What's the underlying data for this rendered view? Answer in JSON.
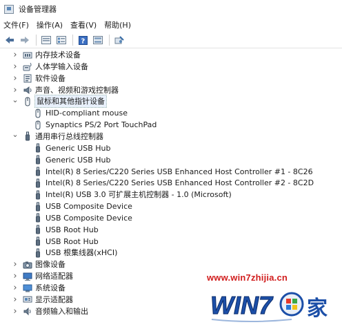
{
  "window": {
    "title": "设备管理器"
  },
  "menu": [
    "文件(F)",
    "操作(A)",
    "查看(V)",
    "帮助(H)"
  ],
  "toolbar": [
    "back-icon",
    "forward-icon",
    "sep",
    "properties-icon",
    "details-icon",
    "sep",
    "help-icon",
    "view-icon",
    "sep",
    "scan-icon"
  ],
  "tree": [
    {
      "depth": 0,
      "expander": "collapsed",
      "icon": "memory-icon",
      "label": "内存技术设备"
    },
    {
      "depth": 0,
      "expander": "collapsed",
      "icon": "human-input-icon",
      "label": "人体学输入设备"
    },
    {
      "depth": 0,
      "expander": "collapsed",
      "icon": "software-device-icon",
      "label": "软件设备"
    },
    {
      "depth": 0,
      "expander": "collapsed",
      "icon": "speaker-icon",
      "label": "声音、视频和游戏控制器"
    },
    {
      "depth": 0,
      "expander": "expanded",
      "icon": "mouse-icon",
      "label": "鼠标和其他指针设备",
      "selected": true
    },
    {
      "depth": 1,
      "expander": "none",
      "icon": "mouse-icon",
      "label": "HID-compliant mouse"
    },
    {
      "depth": 1,
      "expander": "none",
      "icon": "mouse-icon",
      "label": "Synaptics PS/2 Port TouchPad"
    },
    {
      "depth": 0,
      "expander": "expanded",
      "icon": "usb-icon",
      "label": "通用串行总线控制器"
    },
    {
      "depth": 1,
      "expander": "none",
      "icon": "usb-icon",
      "label": "Generic USB Hub"
    },
    {
      "depth": 1,
      "expander": "none",
      "icon": "usb-icon",
      "label": "Generic USB Hub"
    },
    {
      "depth": 1,
      "expander": "none",
      "icon": "usb-icon",
      "label": "Intel(R) 8 Series/C220 Series USB Enhanced Host Controller #1 - 8C26"
    },
    {
      "depth": 1,
      "expander": "none",
      "icon": "usb-icon",
      "label": "Intel(R) 8 Series/C220 Series USB Enhanced Host Controller #2 - 8C2D"
    },
    {
      "depth": 1,
      "expander": "none",
      "icon": "usb-icon",
      "label": "Intel(R) USB 3.0 可扩展主机控制器 - 1.0 (Microsoft)"
    },
    {
      "depth": 1,
      "expander": "none",
      "icon": "usb-icon",
      "label": "USB Composite Device"
    },
    {
      "depth": 1,
      "expander": "none",
      "icon": "usb-icon",
      "label": "USB Composite Device"
    },
    {
      "depth": 1,
      "expander": "none",
      "icon": "usb-icon",
      "label": "USB Root Hub"
    },
    {
      "depth": 1,
      "expander": "none",
      "icon": "usb-icon",
      "label": "USB Root Hub"
    },
    {
      "depth": 1,
      "expander": "none",
      "icon": "usb-icon",
      "label": "USB 根集线器(xHCI)"
    },
    {
      "depth": 0,
      "expander": "collapsed",
      "icon": "camera-icon",
      "label": "图像设备"
    },
    {
      "depth": 0,
      "expander": "collapsed",
      "icon": "network-adapter-icon",
      "label": "网络适配器"
    },
    {
      "depth": 0,
      "expander": "collapsed",
      "icon": "system-device-icon",
      "label": "系统设备"
    },
    {
      "depth": 0,
      "expander": "collapsed",
      "icon": "display-adapter-icon",
      "label": "显示适配器"
    },
    {
      "depth": 0,
      "expander": "collapsed",
      "icon": "audio-io-icon",
      "label": "音频输入和输出"
    }
  ],
  "watermark": {
    "url": "www.win7zhijia.cn",
    "logo_text": "WIN7",
    "logo_suffix": "家"
  }
}
